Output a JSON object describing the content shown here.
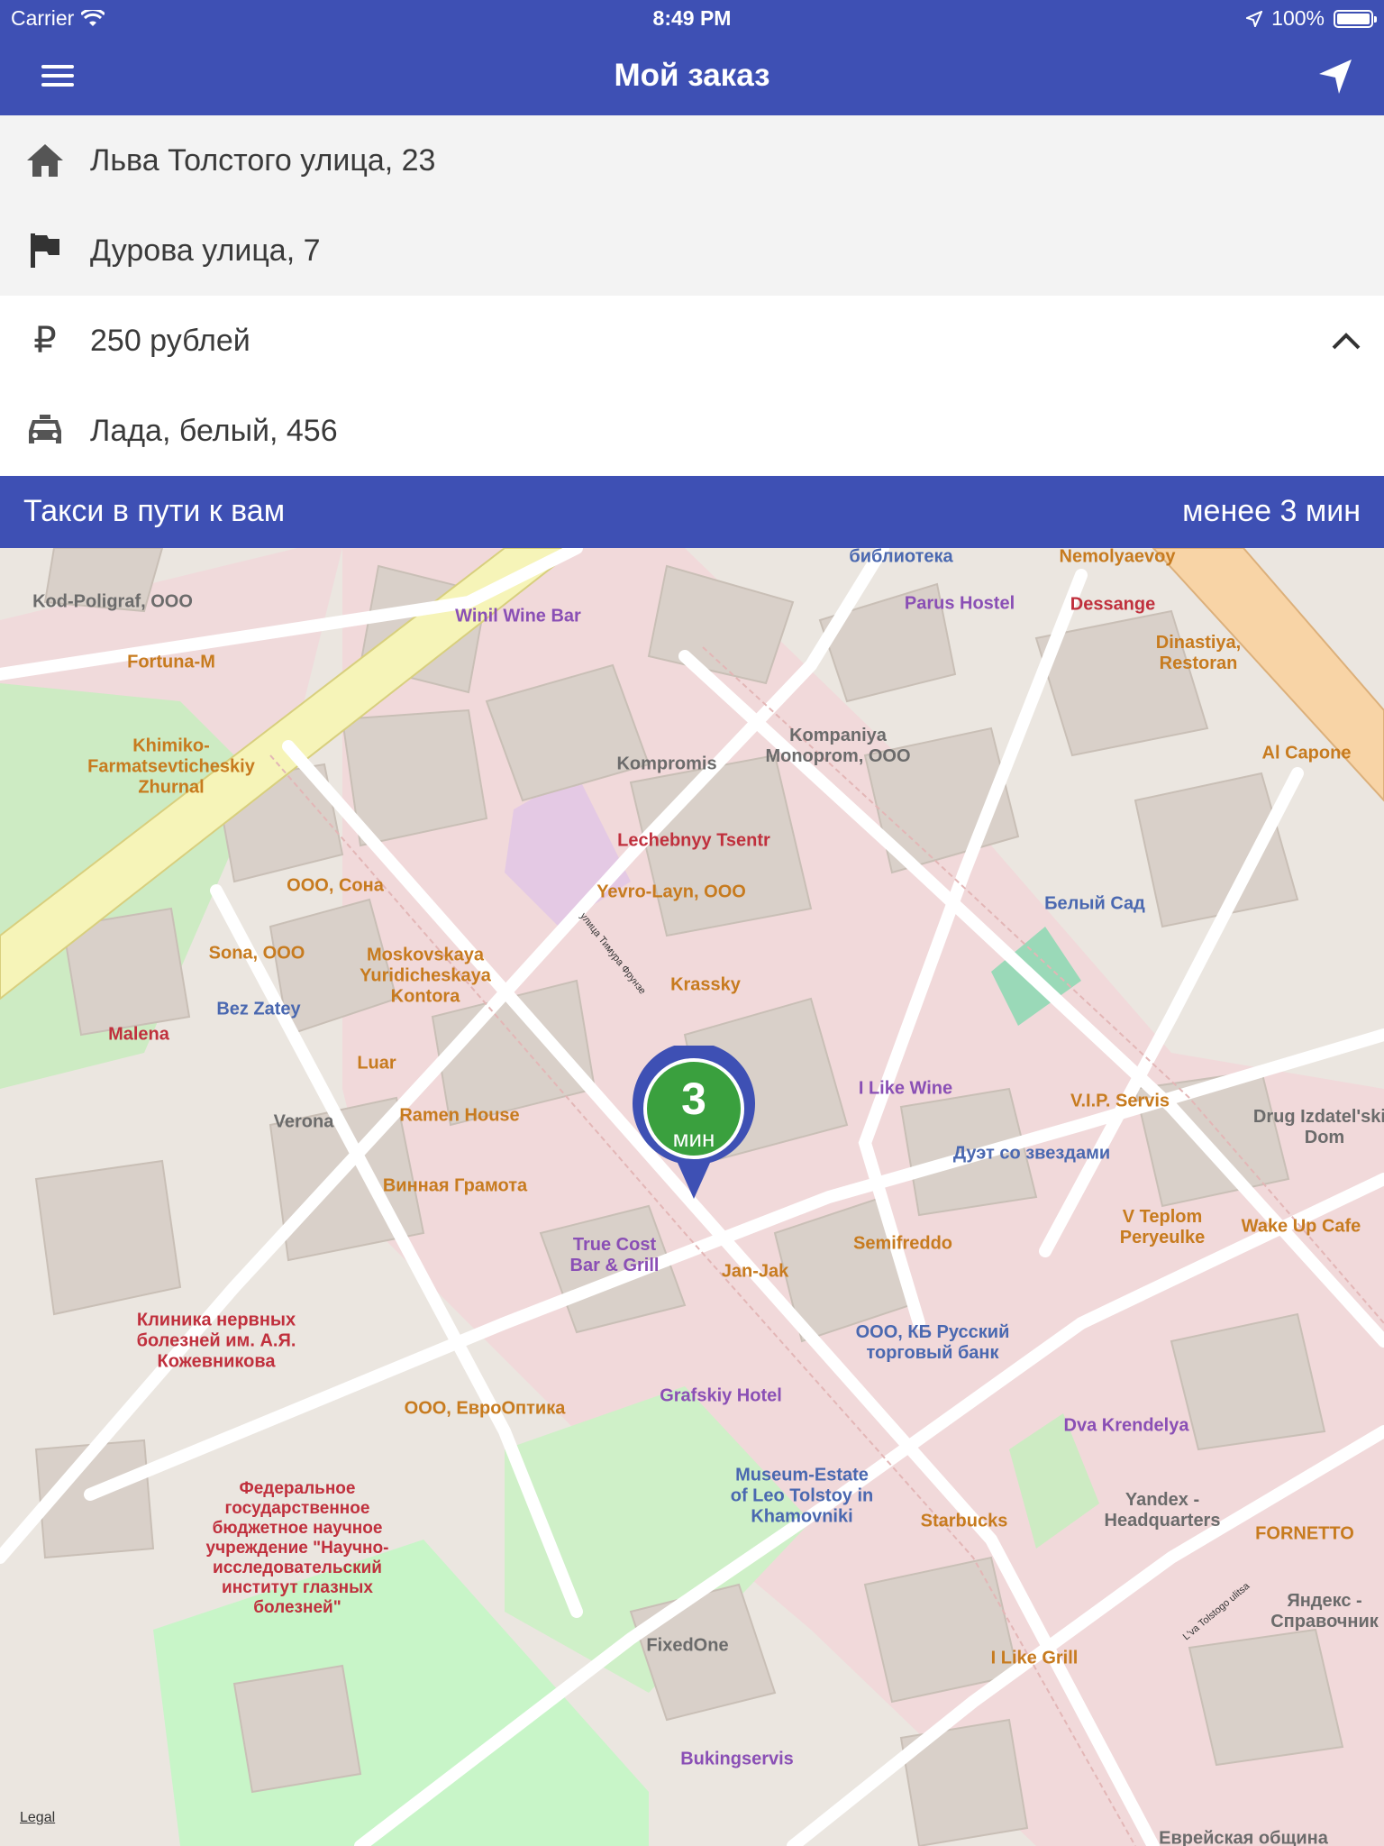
{
  "status_bar": {
    "carrier": "Carrier",
    "time": "8:49 PM",
    "battery": "100%",
    "battery_level": 1.0
  },
  "nav": {
    "title": "Мой заказ",
    "menu_icon": "menu-icon",
    "locate_icon": "location-arrow-icon"
  },
  "order": {
    "pickup": {
      "icon": "home-icon",
      "text": "Льва Толстого улица, 23"
    },
    "destination": {
      "icon": "flag-icon",
      "text": "Дурова улица, 7"
    },
    "price": {
      "icon": "ruble-icon",
      "symbol": "₽",
      "text": "250 рублей"
    },
    "car": {
      "icon": "taxi-icon",
      "text": "Лада, белый, 456"
    },
    "collapse_icon": "chevron-up-icon"
  },
  "trip_status": {
    "message": "Такси в пути к вам",
    "eta": "менее 3 мин"
  },
  "map": {
    "pin": {
      "value": "3",
      "unit": "мин"
    },
    "legal": "Legal",
    "labels": [
      "Kod-Poligraf, ООО",
      "Winil Wine Bar",
      "библиотека",
      "Nemolyaevoy",
      "Parus Hostel",
      "Dessange",
      "Fortuna-M",
      "Dinastiya, Restoran",
      "Khimiko-Farmatsevticheskiy Zhurnal",
      "Kompromis",
      "Kompaniya Monoprom, ООО",
      "Al Capone",
      "Lechebnyy Tsentr",
      "ООО, Сона",
      "Yevro-Layn, ООО",
      "Белый Сад",
      "Sona, ООО",
      "Moskovskaya Yuridicheskaya Kontora",
      "Krassky",
      "Bez Zatey",
      "Malena",
      "Luar",
      "I Like Wine",
      "V.I.P. Servis",
      "Verona",
      "Ramen House",
      "Дуэт со звездами",
      "Drug Izdatel'skiy Dom",
      "Винная Грамота",
      "True Cost Bar & Grill",
      "Semifreddo",
      "V Teplom Peryeulke",
      "Wake Up Cafe",
      "Jan-Jak",
      "ООО, КБ Русский торговый банк",
      "Клиника нервных болезней им. А.Я. Кожевникова",
      "Grafskiy Hotel",
      "ООО, ЕвроОптика",
      "Dva Krendelya",
      "Федеральное государственное бюджетное научное учреждение \"Научно-исследовательский институт глазных болезней\"",
      "Museum-Estate of Leo Tolstoy in Khamovniki",
      "Starbucks",
      "Yandex - Headquarters",
      "FORNETTO",
      "FixedOne",
      "I Like Grill",
      "Яндекс - Справочник",
      "Bukingservis",
      "Еврейская община"
    ]
  }
}
